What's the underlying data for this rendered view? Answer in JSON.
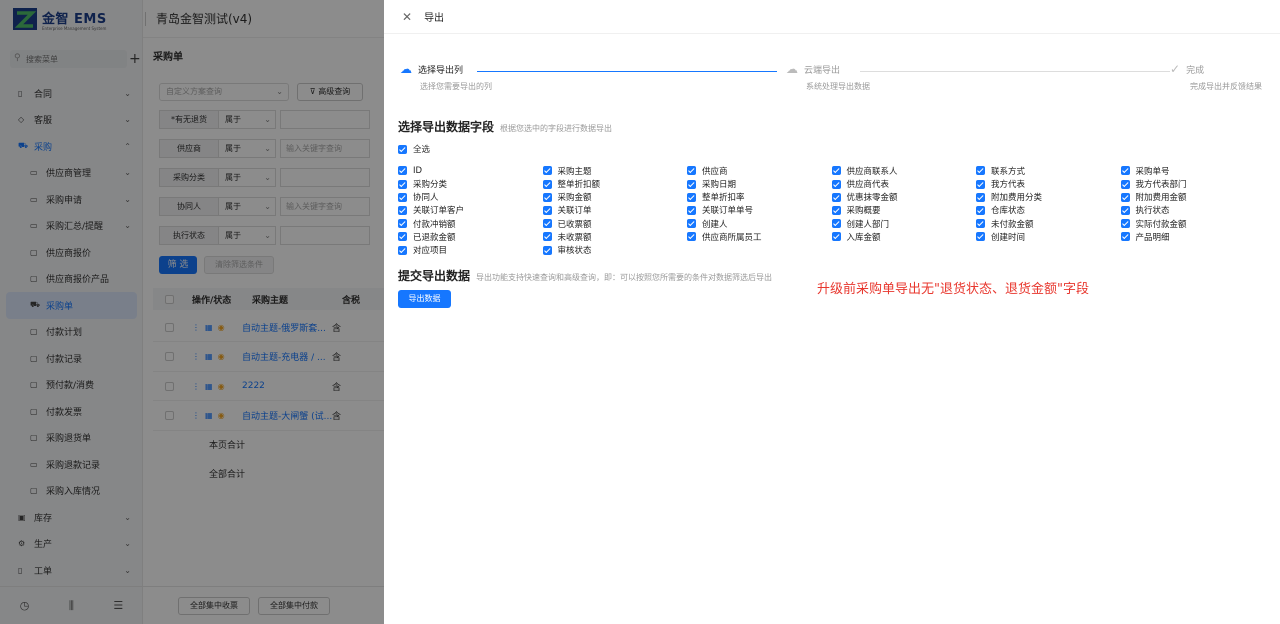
{
  "brand": {
    "name": "金智 EMS",
    "sub": "Enterprise Management System"
  },
  "header": {
    "title": "青岛金智测试(v4)"
  },
  "sidebar": {
    "search_placeholder": "搜索菜单",
    "items": [
      {
        "label": "合同",
        "icon": "document-icon",
        "type": "top",
        "chevron": "⌄"
      },
      {
        "label": "客服",
        "icon": "code-icon",
        "type": "top",
        "chevron": "⌄"
      },
      {
        "label": "采购",
        "icon": "cart-icon",
        "type": "open",
        "chevron": "⌃"
      },
      {
        "label": "供应商管理",
        "icon": "folder-icon",
        "type": "sub",
        "chevron": "⌄"
      },
      {
        "label": "采购申请",
        "icon": "folder-icon",
        "type": "sub",
        "chevron": "⌄"
      },
      {
        "label": "采购汇总/提醒",
        "icon": "folder-icon",
        "type": "sub",
        "chevron": "⌄"
      },
      {
        "label": "供应商报价",
        "icon": "file-icon",
        "type": "sub",
        "chevron": ""
      },
      {
        "label": "供应商报价产品",
        "icon": "file-icon",
        "type": "sub",
        "chevron": ""
      },
      {
        "label": "采购单",
        "icon": "cart-icon",
        "type": "active",
        "chevron": ""
      },
      {
        "label": "付款计划",
        "icon": "file-icon",
        "type": "sub",
        "chevron": ""
      },
      {
        "label": "付款记录",
        "icon": "file-icon",
        "type": "sub",
        "chevron": ""
      },
      {
        "label": "预付款/消费",
        "icon": "file-icon",
        "type": "sub",
        "chevron": ""
      },
      {
        "label": "付款发票",
        "icon": "file-icon",
        "type": "sub",
        "chevron": ""
      },
      {
        "label": "采购退货单",
        "icon": "file-icon",
        "type": "sub",
        "chevron": ""
      },
      {
        "label": "采购退款记录",
        "icon": "folder-icon",
        "type": "sub",
        "chevron": ""
      },
      {
        "label": "采购入库情况",
        "icon": "file-icon",
        "type": "sub",
        "chevron": ""
      },
      {
        "label": "库存",
        "icon": "box-icon",
        "type": "top",
        "chevron": "⌄"
      },
      {
        "label": "生产",
        "icon": "gear-icon",
        "type": "top",
        "chevron": "⌄"
      },
      {
        "label": "工单",
        "icon": "document-icon",
        "type": "top",
        "chevron": "⌄"
      }
    ]
  },
  "main": {
    "page_title": "采购单",
    "filter_scheme_placeholder": "自定义方案查询",
    "advanced_query": "高级查询",
    "filters": [
      {
        "label": "*有无退货",
        "op": "属于",
        "value": ""
      },
      {
        "label": "供应商",
        "op": "属于",
        "value": "输入关键字查询"
      },
      {
        "label": "采购分类",
        "op": "属于",
        "value": ""
      },
      {
        "label": "协同人",
        "op": "属于",
        "value": "输入关键字查询"
      },
      {
        "label": "执行状态",
        "op": "属于",
        "value": ""
      }
    ],
    "filter_btn": "筛 选",
    "clear_btn": "清除筛选条件",
    "table": {
      "headers": [
        "操作/状态",
        "采购主题",
        "含税"
      ],
      "rows": [
        {
          "subject": "自动主题-俄罗斯套...",
          "tax": "含"
        },
        {
          "subject": "自动主题-充电器 / ...",
          "tax": "含"
        },
        {
          "subject": "2222",
          "tax": "含"
        },
        {
          "subject": "自动主题-大闸蟹 (试...",
          "tax": "含"
        }
      ],
      "page_total": "本页合计",
      "all_total": "全部合计"
    },
    "bottom_buttons": [
      "全部集中收票",
      "全部集中付款"
    ]
  },
  "drawer": {
    "title": "导出",
    "steps": [
      {
        "title": "选择导出列",
        "desc": "选择您需要导出的列",
        "state": "active",
        "icon": "cloud-upload-icon"
      },
      {
        "title": "云端导出",
        "desc": "系统处理导出数据",
        "state": "wait",
        "icon": "cloud-icon"
      },
      {
        "title": "完成",
        "desc": "完成导出并反馈结果",
        "state": "wait",
        "icon": "check-circle-icon"
      }
    ],
    "select_section": {
      "title": "选择导出数据字段",
      "hint": "根据您选中的字段进行数据导出"
    },
    "select_all": "全选",
    "fields": [
      "ID",
      "采购主题",
      "供应商",
      "供应商联系人",
      "联系方式",
      "采购单号",
      "采购分类",
      "整单折扣额",
      "采购日期",
      "供应商代表",
      "我方代表",
      "我方代表部门",
      "协同人",
      "采购金额",
      "整单折扣率",
      "优惠抹零金额",
      "附加费用分类",
      "附加费用金额",
      "关联订单客户",
      "关联订单",
      "关联订单单号",
      "采购概要",
      "仓库状态",
      "执行状态",
      "付款冲销额",
      "已收票额",
      "创建人",
      "创建人部门",
      "未付款金额",
      "实际付款金额",
      "已退款金额",
      "未收票额",
      "供应商所属员工",
      "入库金额",
      "创建时间",
      "产品明细",
      "对应项目",
      "审核状态"
    ],
    "submit_section": {
      "title": "提交导出数据",
      "hint": "导出功能支持快速查询和高级查询，即：可以按照您所需要的条件对数据筛选后导出"
    },
    "export_btn": "导出数据",
    "annotation": "升级前采购单导出无\"退货状态、退货金额\"字段"
  },
  "colors": {
    "primary": "#1677ff",
    "annotation": "#e8372e"
  }
}
